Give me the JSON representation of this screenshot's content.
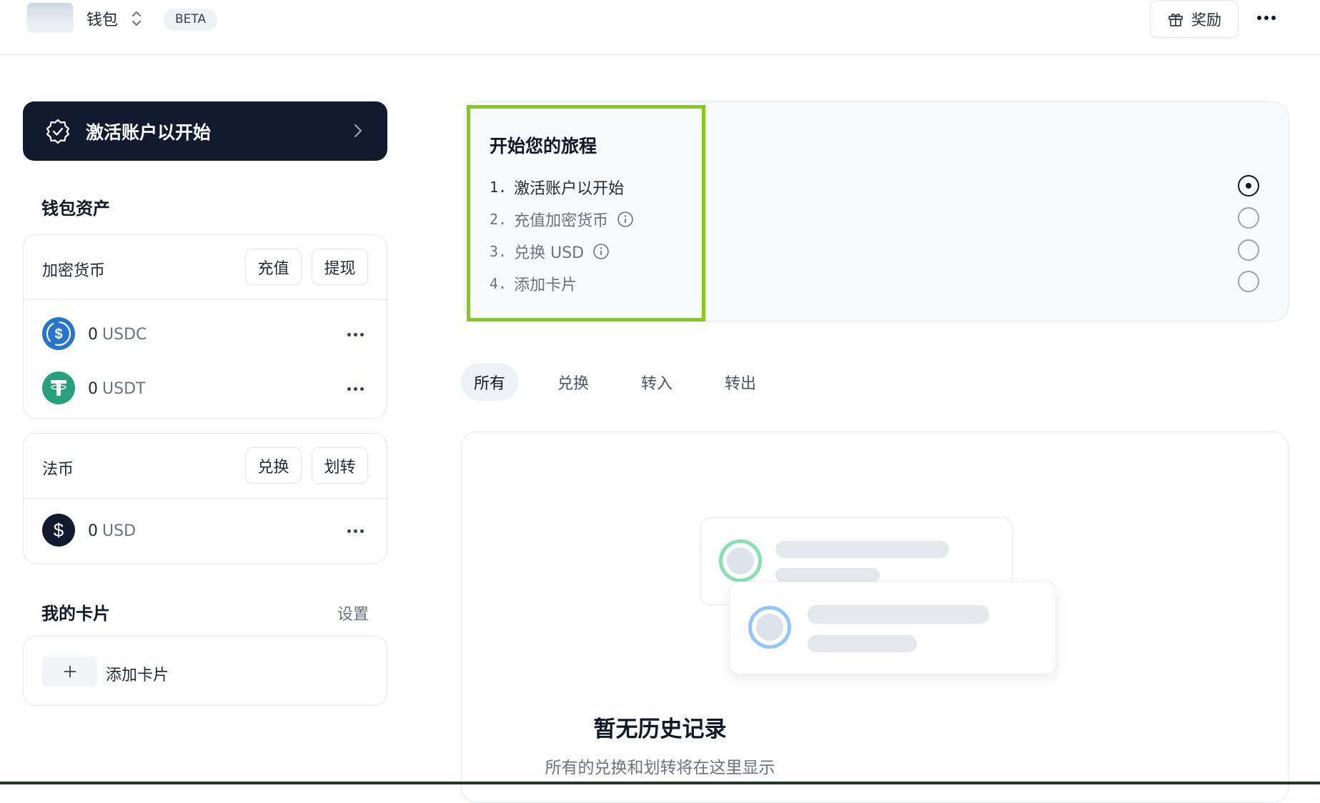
{
  "header": {
    "wallet_title": "钱包",
    "beta_badge": "BETA",
    "reward_label": "奖励",
    "icons": [
      "wallet-thumbnail",
      "switch-icon",
      "gift-icon",
      "more-icon"
    ]
  },
  "sidebar": {
    "activate_label": "激活账户以开始",
    "assets_heading": "钱包资产",
    "crypto": {
      "title": "加密货币",
      "deposit_label": "充值",
      "withdraw_label": "提现",
      "items": [
        {
          "amount": "0",
          "unit": "USDC",
          "icon": "usdc-icon",
          "color": "#2775ca"
        },
        {
          "amount": "0",
          "unit": "USDT",
          "icon": "usdt-icon",
          "color": "#26a17b"
        }
      ]
    },
    "fiat": {
      "title": "法币",
      "exchange_label": "兑换",
      "transfer_label": "划转",
      "items": [
        {
          "amount": "0",
          "unit": "USD",
          "icon": "usd-icon",
          "color": "#111a2e"
        }
      ]
    },
    "cards_heading": "我的卡片",
    "settings_label": "设置",
    "add_card_label": "添加卡片"
  },
  "journey": {
    "title": "开始您的旅程",
    "steps": [
      {
        "num": "1.",
        "label": "激活账户以开始",
        "state": "current"
      },
      {
        "num": "2.",
        "label": "充值加密货币",
        "state": "todo",
        "info": true
      },
      {
        "num": "3.",
        "label": "兑换 USD",
        "state": "todo",
        "info": true
      },
      {
        "num": "4.",
        "label": "添加卡片",
        "state": "todo"
      }
    ],
    "highlight_color": "#84cc16"
  },
  "tabs": [
    "所有",
    "兑换",
    "转入",
    "转出"
  ],
  "active_tab": "所有",
  "history": {
    "empty_title": "暂无历史记录",
    "empty_subtitle": "所有的兑换和划转将在这里显示"
  },
  "colors": {
    "accent_dark": "#111a2e",
    "ring_green": "#86e0b5",
    "ring_blue": "#93c5fd"
  }
}
